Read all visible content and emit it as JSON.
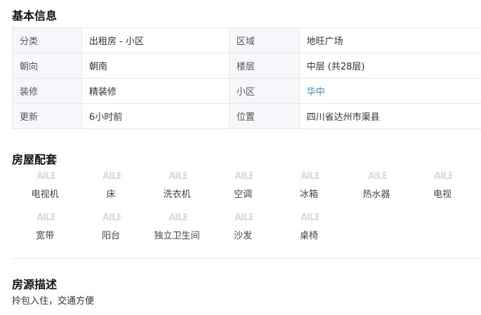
{
  "basic": {
    "title": "基本信息",
    "rows": [
      {
        "k1": "分类",
        "v1": "出租房 - 小区",
        "k2": "区域",
        "v2": "地旺广场"
      },
      {
        "k1": "朝向",
        "v1": "朝南",
        "k2": "楼层",
        "v2": "中层 (共28层)"
      },
      {
        "k1": "装修",
        "v1": "精装修",
        "k2": "小区",
        "v2": "华中"
      },
      {
        "k1": "更新",
        "v1": "6小时前",
        "k2": "位置",
        "v2": "四川省达州市渠县"
      }
    ]
  },
  "amenities": {
    "title": "房屋配套",
    "icon_text": "AILE",
    "items": [
      {
        "label": "电视机"
      },
      {
        "label": "床"
      },
      {
        "label": "洗衣机"
      },
      {
        "label": "空调"
      },
      {
        "label": "冰箱"
      },
      {
        "label": "热水器"
      },
      {
        "label": "电视"
      },
      {
        "label": "宽带"
      },
      {
        "label": "阳台"
      },
      {
        "label": "独立卫生间"
      },
      {
        "label": "沙发"
      },
      {
        "label": "桌椅"
      }
    ]
  },
  "description": {
    "title": "房源描述",
    "text": "拎包入住，交通方便"
  }
}
